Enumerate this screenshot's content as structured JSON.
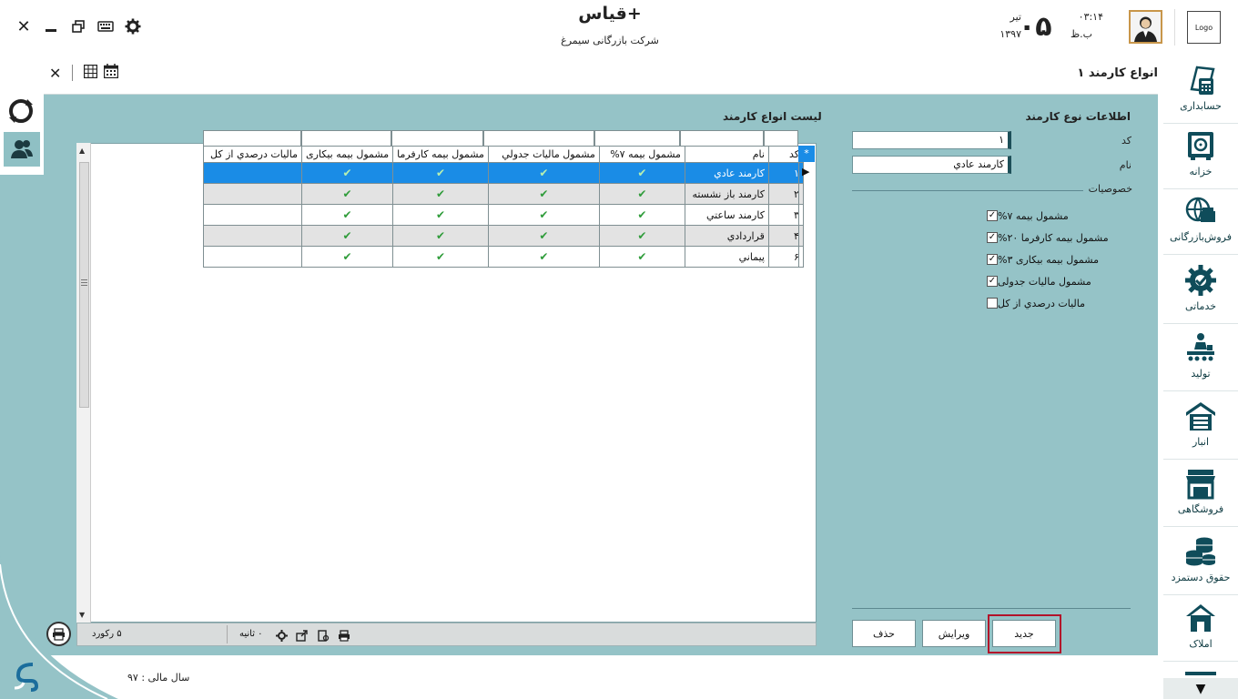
{
  "header": {
    "app_title": "قیاس+",
    "company": "شرکت بازرگانی سیمرغ",
    "day": "۰۵",
    "month": "تیر",
    "year": "۱۳۹۷",
    "time": "۰۳:۱۴",
    "ampm": "ب.ظ",
    "logo_text": "Logo"
  },
  "form": {
    "title": "انواع کارمند ۱",
    "section_title": "اطلاعات نوع کارمند",
    "code_label": "کد",
    "code_value": "۱",
    "name_label": "نام",
    "name_value": "کارمند عادي",
    "features_label": "خصوصیات",
    "checks": [
      {
        "label": "مشمول بیمه ۷%",
        "checked": true
      },
      {
        "label": "مشمول بیمه کارفرما ۲۰%",
        "checked": true
      },
      {
        "label": "مشمول بیمه بیکاری ۳%",
        "checked": true
      },
      {
        "label": "مشمول مالیات جدولی",
        "checked": true
      },
      {
        "label": "مالیات درصدي از کل",
        "checked": false
      }
    ],
    "btn_new": "جدید",
    "btn_edit": "ویرایش",
    "btn_delete": "حذف"
  },
  "grid": {
    "title": "لیست انواع کارمند",
    "columns": [
      "کد",
      "نام",
      "مشمول بیمه ۷%",
      "مشمول مالیات جدولي",
      "مشمول بیمه کارفرما",
      "مشمول بیمه بیکاری",
      "مالیات درصدي از کل"
    ],
    "rows": [
      {
        "code": "۱",
        "name": "کارمند عادي",
        "c1": true,
        "c2": true,
        "c3": true,
        "c4": true,
        "c5": false
      },
      {
        "code": "۲",
        "name": "کارمند باز نشسته",
        "c1": true,
        "c2": true,
        "c3": true,
        "c4": true,
        "c5": false
      },
      {
        "code": "۳",
        "name": "کارمند ساعتي",
        "c1": true,
        "c2": true,
        "c3": true,
        "c4": true,
        "c5": false
      },
      {
        "code": "۴",
        "name": "قراردادي",
        "c1": true,
        "c2": true,
        "c3": true,
        "c4": true,
        "c5": false
      },
      {
        "code": "۶",
        "name": "پیماني",
        "c1": true,
        "c2": true,
        "c3": true,
        "c4": true,
        "c5": false
      }
    ],
    "record_count": "۵ رکورد",
    "seconds": "۰ ثانیه"
  },
  "status": {
    "fiscal_year": "سال مالی : ۹۷"
  },
  "sidebar": {
    "items": [
      {
        "label": "حسابداری",
        "icon": "accounting-icon"
      },
      {
        "label": "خزانه",
        "icon": "treasury-icon"
      },
      {
        "label": "فروش‌بازرگانی",
        "icon": "commerce-icon"
      },
      {
        "label": "خدماتی",
        "icon": "services-icon"
      },
      {
        "label": "تولید",
        "icon": "production-icon"
      },
      {
        "label": "انبار",
        "icon": "warehouse-icon"
      },
      {
        "label": "فروشگاهی",
        "icon": "store-icon"
      },
      {
        "label": "حقوق دستمزد",
        "icon": "payroll-icon"
      },
      {
        "label": "املاک",
        "icon": "realestate-icon"
      }
    ]
  },
  "colors": {
    "panel": "#95c3c7",
    "selected_row": "#1a8ce6",
    "accent_dark": "#1d4f58",
    "highlight": "#b2132a"
  }
}
